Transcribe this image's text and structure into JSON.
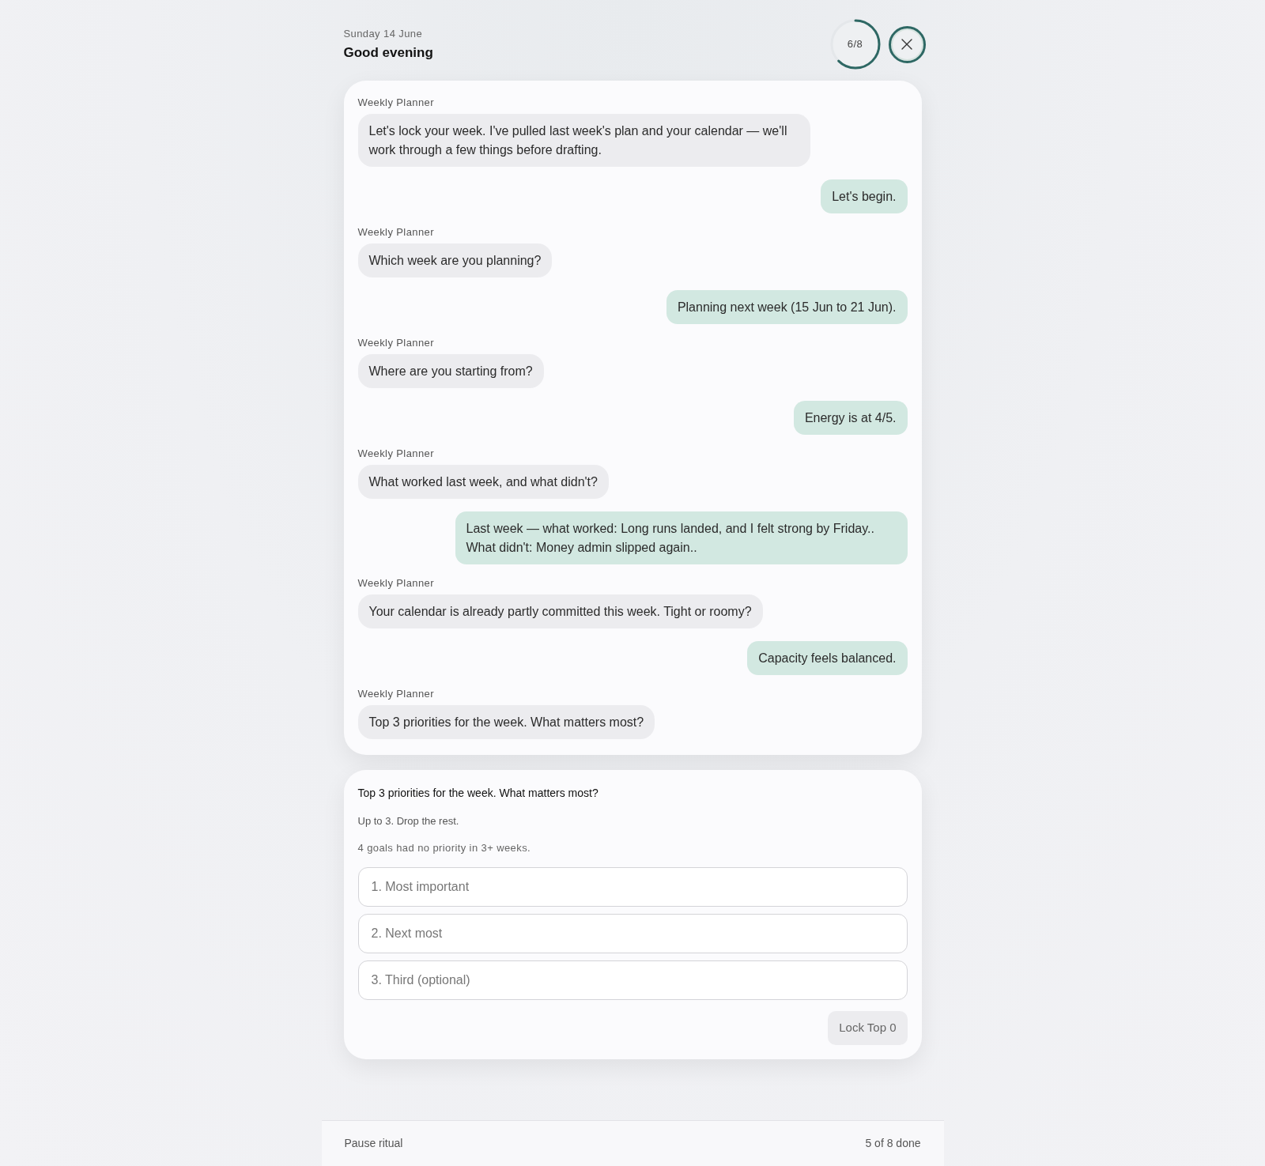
{
  "header": {
    "date": "Sunday 14 June",
    "greeting": "Good evening",
    "progress": {
      "label": "6/8",
      "level": 0.625
    }
  },
  "chat": {
    "messages": [
      {
        "kind": "agent",
        "author": "Weekly Planner",
        "text": "Let's lock your week. I've pulled last week's plan and your calendar — we'll work through a few things before drafting."
      },
      {
        "kind": "user",
        "text": "Let's begin."
      },
      {
        "kind": "agent",
        "author": "Weekly Planner",
        "text": "Which week are you planning?"
      },
      {
        "kind": "user",
        "text": "Planning next week (15 Jun to 21 Jun)."
      },
      {
        "kind": "agent",
        "author": "Weekly Planner",
        "text": "Where are you starting from?"
      },
      {
        "kind": "user",
        "text": "Energy is at 4/5."
      },
      {
        "kind": "agent",
        "author": "Weekly Planner",
        "text": "What worked last week, and what didn't?"
      },
      {
        "kind": "user",
        "text": "Last week — what worked: Long runs landed, and I felt strong by Friday.. What didn't: Money admin slipped again.."
      },
      {
        "kind": "agent",
        "author": "Weekly Planner",
        "text": "Your calendar is already partly committed this week. Tight or roomy?"
      },
      {
        "kind": "user",
        "text": "Capacity feels balanced."
      },
      {
        "kind": "agent",
        "author": "Weekly Planner",
        "text": "Top 3 priorities for the week. What matters most?"
      }
    ]
  },
  "priorities": {
    "title": "Top 3 priorities for the week. What matters most?",
    "subtitle": "Up to 3. Drop the rest.",
    "hint": "4 goals had no priority in 3+ weeks.",
    "inputs": [
      {
        "placeholder": "1. Most important"
      },
      {
        "placeholder": "2. Next most"
      },
      {
        "placeholder": "3. Third (optional)"
      }
    ],
    "button": {
      "label": "Lock Top 0",
      "disabled": true
    }
  },
  "footer": {
    "pause": "Pause ritual",
    "status": "5 of 8 done"
  }
}
